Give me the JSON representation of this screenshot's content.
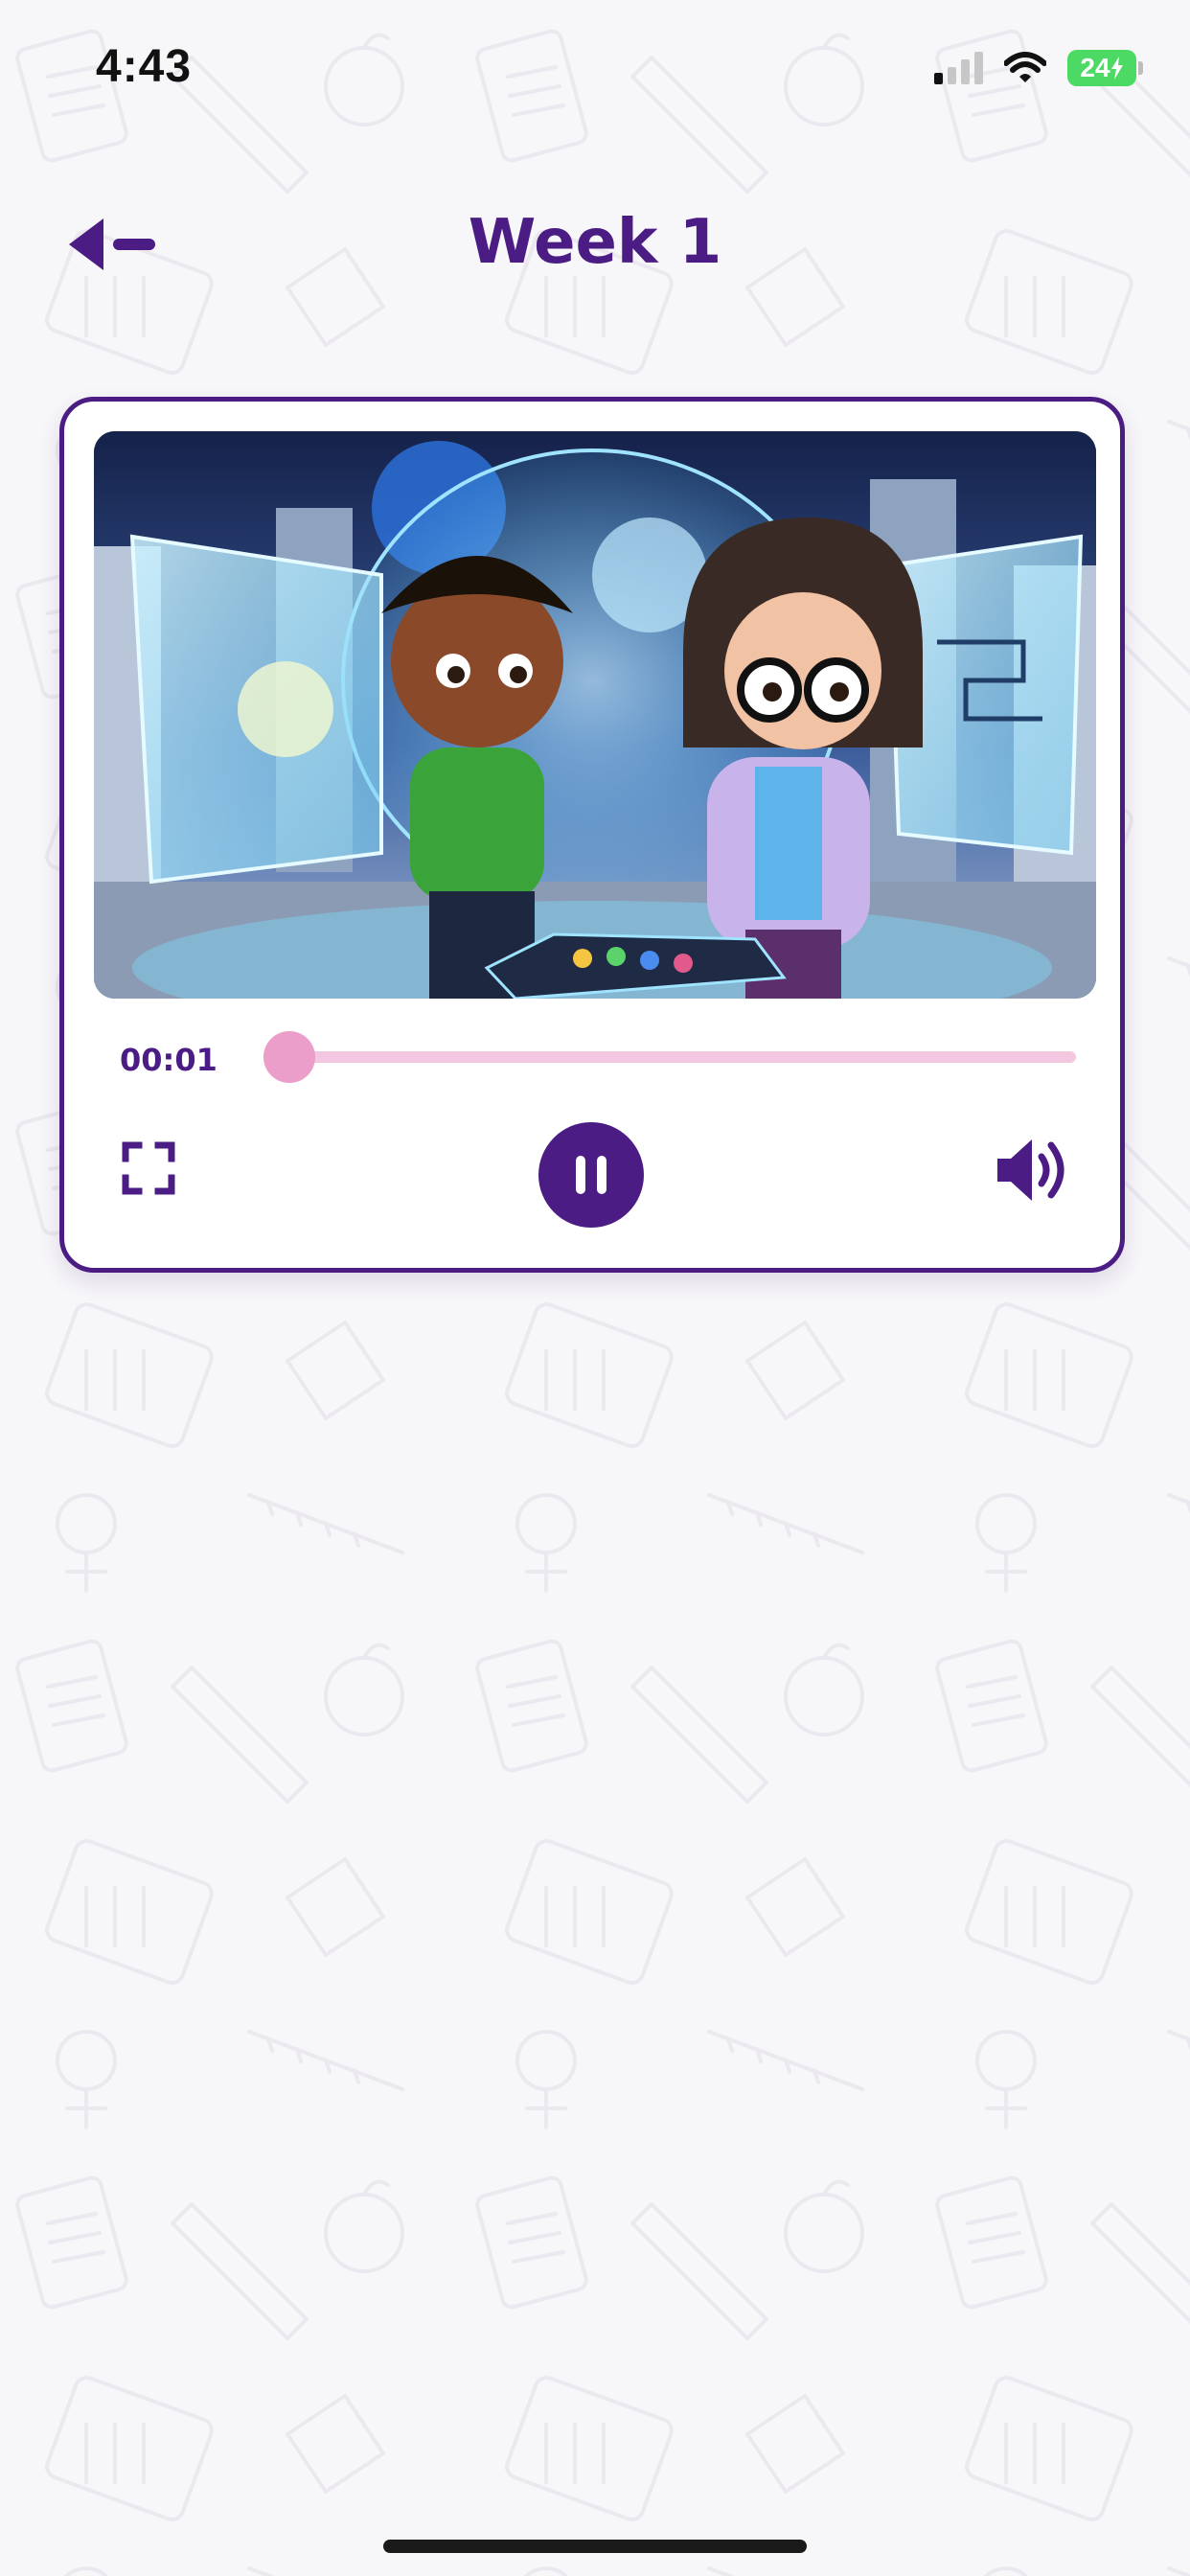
{
  "status_bar": {
    "time": "4:43",
    "battery": "24",
    "icons": [
      "cellular-signal-icon",
      "wifi-icon",
      "battery-charging-icon"
    ]
  },
  "header": {
    "title": "Week 1",
    "back_icon": "arrow-left-icon"
  },
  "player": {
    "current_time": "00:01",
    "progress": 0.03,
    "state": "playing",
    "controls": [
      "fullscreen-icon",
      "pause-icon",
      "volume-icon"
    ]
  },
  "colors": {
    "brand_purple": "#4b1d84",
    "progress_pink": "#ea9ec9",
    "progress_track": "#f2c7df",
    "background": "#f7f6f9",
    "battery_green": "#4cd964"
  }
}
